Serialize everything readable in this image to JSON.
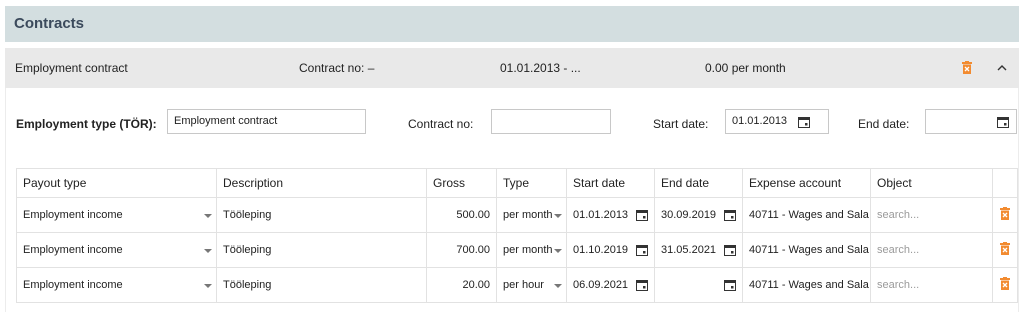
{
  "section": {
    "title": "Contracts"
  },
  "contract_bar": {
    "type": "Employment contract",
    "contract_no": "Contract no: –",
    "date_range": "01.01.2013 - ...",
    "amount": "0.00 per month"
  },
  "form": {
    "employment_type_label": "Employment type (TÖR):",
    "employment_type_value": "Employment contract",
    "contract_no_label": "Contract no:",
    "contract_no_value": "",
    "start_date_label": "Start date:",
    "start_date_value": "01.01.2013",
    "end_date_label": "End date:",
    "end_date_value": ""
  },
  "table": {
    "headers": [
      "Payout type",
      "Description",
      "Gross",
      "Type",
      "Start date",
      "End date",
      "Expense account",
      "Object",
      ""
    ],
    "rows": [
      {
        "payout_type": "Employment income",
        "description": "Tööleping",
        "gross": "500.00",
        "type": "per month",
        "start": "01.01.2013",
        "end": "30.09.2019",
        "account": "40711 - Wages and Sala",
        "object_placeholder": "search..."
      },
      {
        "payout_type": "Employment income",
        "description": "Tööleping",
        "gross": "700.00",
        "type": "per month",
        "start": "01.10.2019",
        "end": "31.05.2021",
        "account": "40711 - Wages and Sala",
        "object_placeholder": "search..."
      },
      {
        "payout_type": "Employment income",
        "description": "Tööleping",
        "gross": "20.00",
        "type": "per hour",
        "start": "06.09.2021",
        "end": "",
        "account": "40711 - Wages and Sala",
        "object_placeholder": "search..."
      }
    ]
  },
  "icons": {
    "delete": "trash-icon",
    "collapse": "chevron-up-icon",
    "calendar": "calendar-icon",
    "dropdown": "caret-down-icon"
  },
  "colors": {
    "header_bg": "#d3dee0",
    "title_color": "#3b4a5c",
    "bar_bg": "#e9e9e9",
    "delete_accent": "#f28b30"
  }
}
